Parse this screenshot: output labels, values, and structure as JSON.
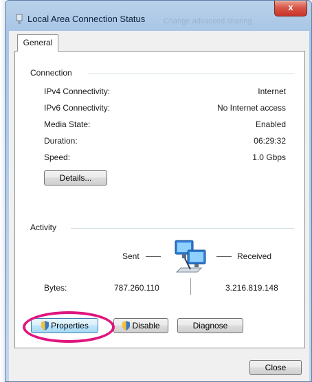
{
  "window": {
    "title": "Local Area Connection Status",
    "title_ghost": "Change advanced sharing",
    "close_label": "x"
  },
  "tabs": [
    {
      "label": "General",
      "selected": true
    }
  ],
  "connection": {
    "group_label": "Connection",
    "rows": [
      {
        "label": "IPv4 Connectivity:",
        "value": "Internet"
      },
      {
        "label": "IPv6 Connectivity:",
        "value": "No Internet access"
      },
      {
        "label": "Media State:",
        "value": "Enabled"
      },
      {
        "label": "Duration:",
        "value": "06:29:32"
      },
      {
        "label": "Speed:",
        "value": "1.0 Gbps"
      }
    ],
    "details_button": "Details..."
  },
  "activity": {
    "group_label": "Activity",
    "sent_label": "Sent",
    "received_label": "Received",
    "bytes_label": "Bytes:",
    "bytes_sent": "787.260.110",
    "bytes_received": "3.216.819.148",
    "icon": "network-computers-icon"
  },
  "buttons": {
    "properties": "Properties",
    "disable": "Disable",
    "diagnose": "Diagnose",
    "close": "Close"
  },
  "colors": {
    "highlight": "#e0157f",
    "titlebar": "#b9d1ea",
    "close_button": "#c8332a"
  }
}
